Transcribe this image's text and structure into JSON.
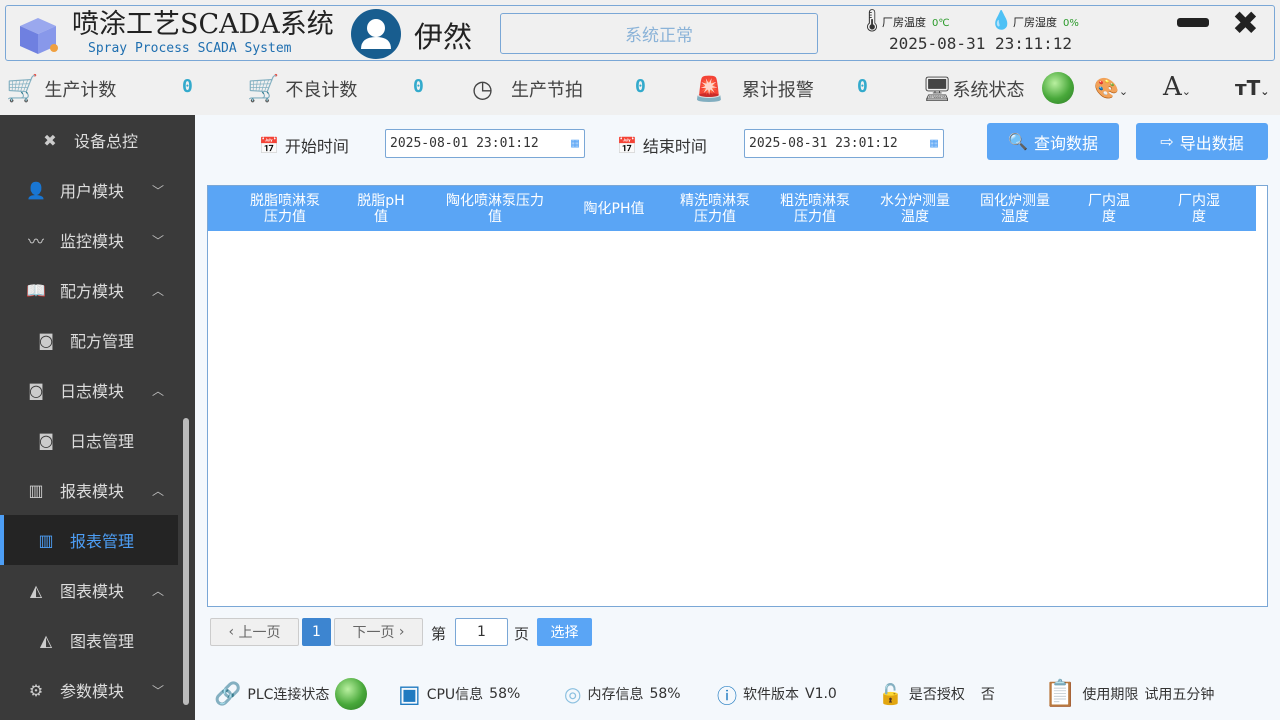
{
  "header": {
    "title": "喷涂工艺SCADA系统",
    "subtitle": "Spray Process SCADA System",
    "user": "伊然",
    "status": "系统正常",
    "temp_label": "厂房温度",
    "temp_value": "0℃",
    "hum_label": "厂房湿度",
    "hum_value": "0%",
    "datetime": "2025-08-31 23:11:12"
  },
  "toolbar": {
    "items": [
      {
        "label": "生产计数",
        "value": "0"
      },
      {
        "label": "不良计数",
        "value": "0"
      },
      {
        "label": "生产节拍",
        "value": "0"
      },
      {
        "label": "累计报警",
        "value": "0"
      }
    ],
    "system_status": "系统状态"
  },
  "sidebar": {
    "items": [
      {
        "label": "设备总控"
      },
      {
        "label": "用户模块"
      },
      {
        "label": "监控模块"
      },
      {
        "label": "配方模块"
      },
      {
        "label": "配方管理"
      },
      {
        "label": "日志模块"
      },
      {
        "label": "日志管理"
      },
      {
        "label": "报表模块"
      },
      {
        "label": "报表管理"
      },
      {
        "label": "图表模块"
      },
      {
        "label": "图表管理"
      },
      {
        "label": "参数模块"
      }
    ]
  },
  "filter": {
    "start_label": "开始时间",
    "start_value": "2025-08-01 23:01:12",
    "end_label": "结束时间",
    "end_value": "2025-08-31 23:01:12",
    "query": "查询数据",
    "export": "导出数据"
  },
  "table": {
    "columns": [
      "脱脂喷淋泵压力值",
      "脱脂pH值",
      "陶化喷淋泵压力值",
      "陶化PH值",
      "精洗喷淋泵压力值",
      "粗洗喷淋泵压力值",
      "水分炉测量温度",
      "固化炉测量温度",
      "厂内温度",
      "厂内湿度"
    ],
    "rows": []
  },
  "pager": {
    "prev": "上一页",
    "current": "1",
    "next": "下一页",
    "page_prefix": "第",
    "page_input": "1",
    "page_suffix": "页",
    "go": "选择"
  },
  "statusbar": {
    "plc": "PLC连接状态",
    "cpu_label": "CPU信息",
    "cpu": "58%",
    "mem_label": "内存信息",
    "mem": "58%",
    "ver_label": "软件版本",
    "ver": "V1.0",
    "auth_label": "是否授权",
    "auth": "否",
    "period_label": "使用期限",
    "period": "试用五分钟"
  }
}
